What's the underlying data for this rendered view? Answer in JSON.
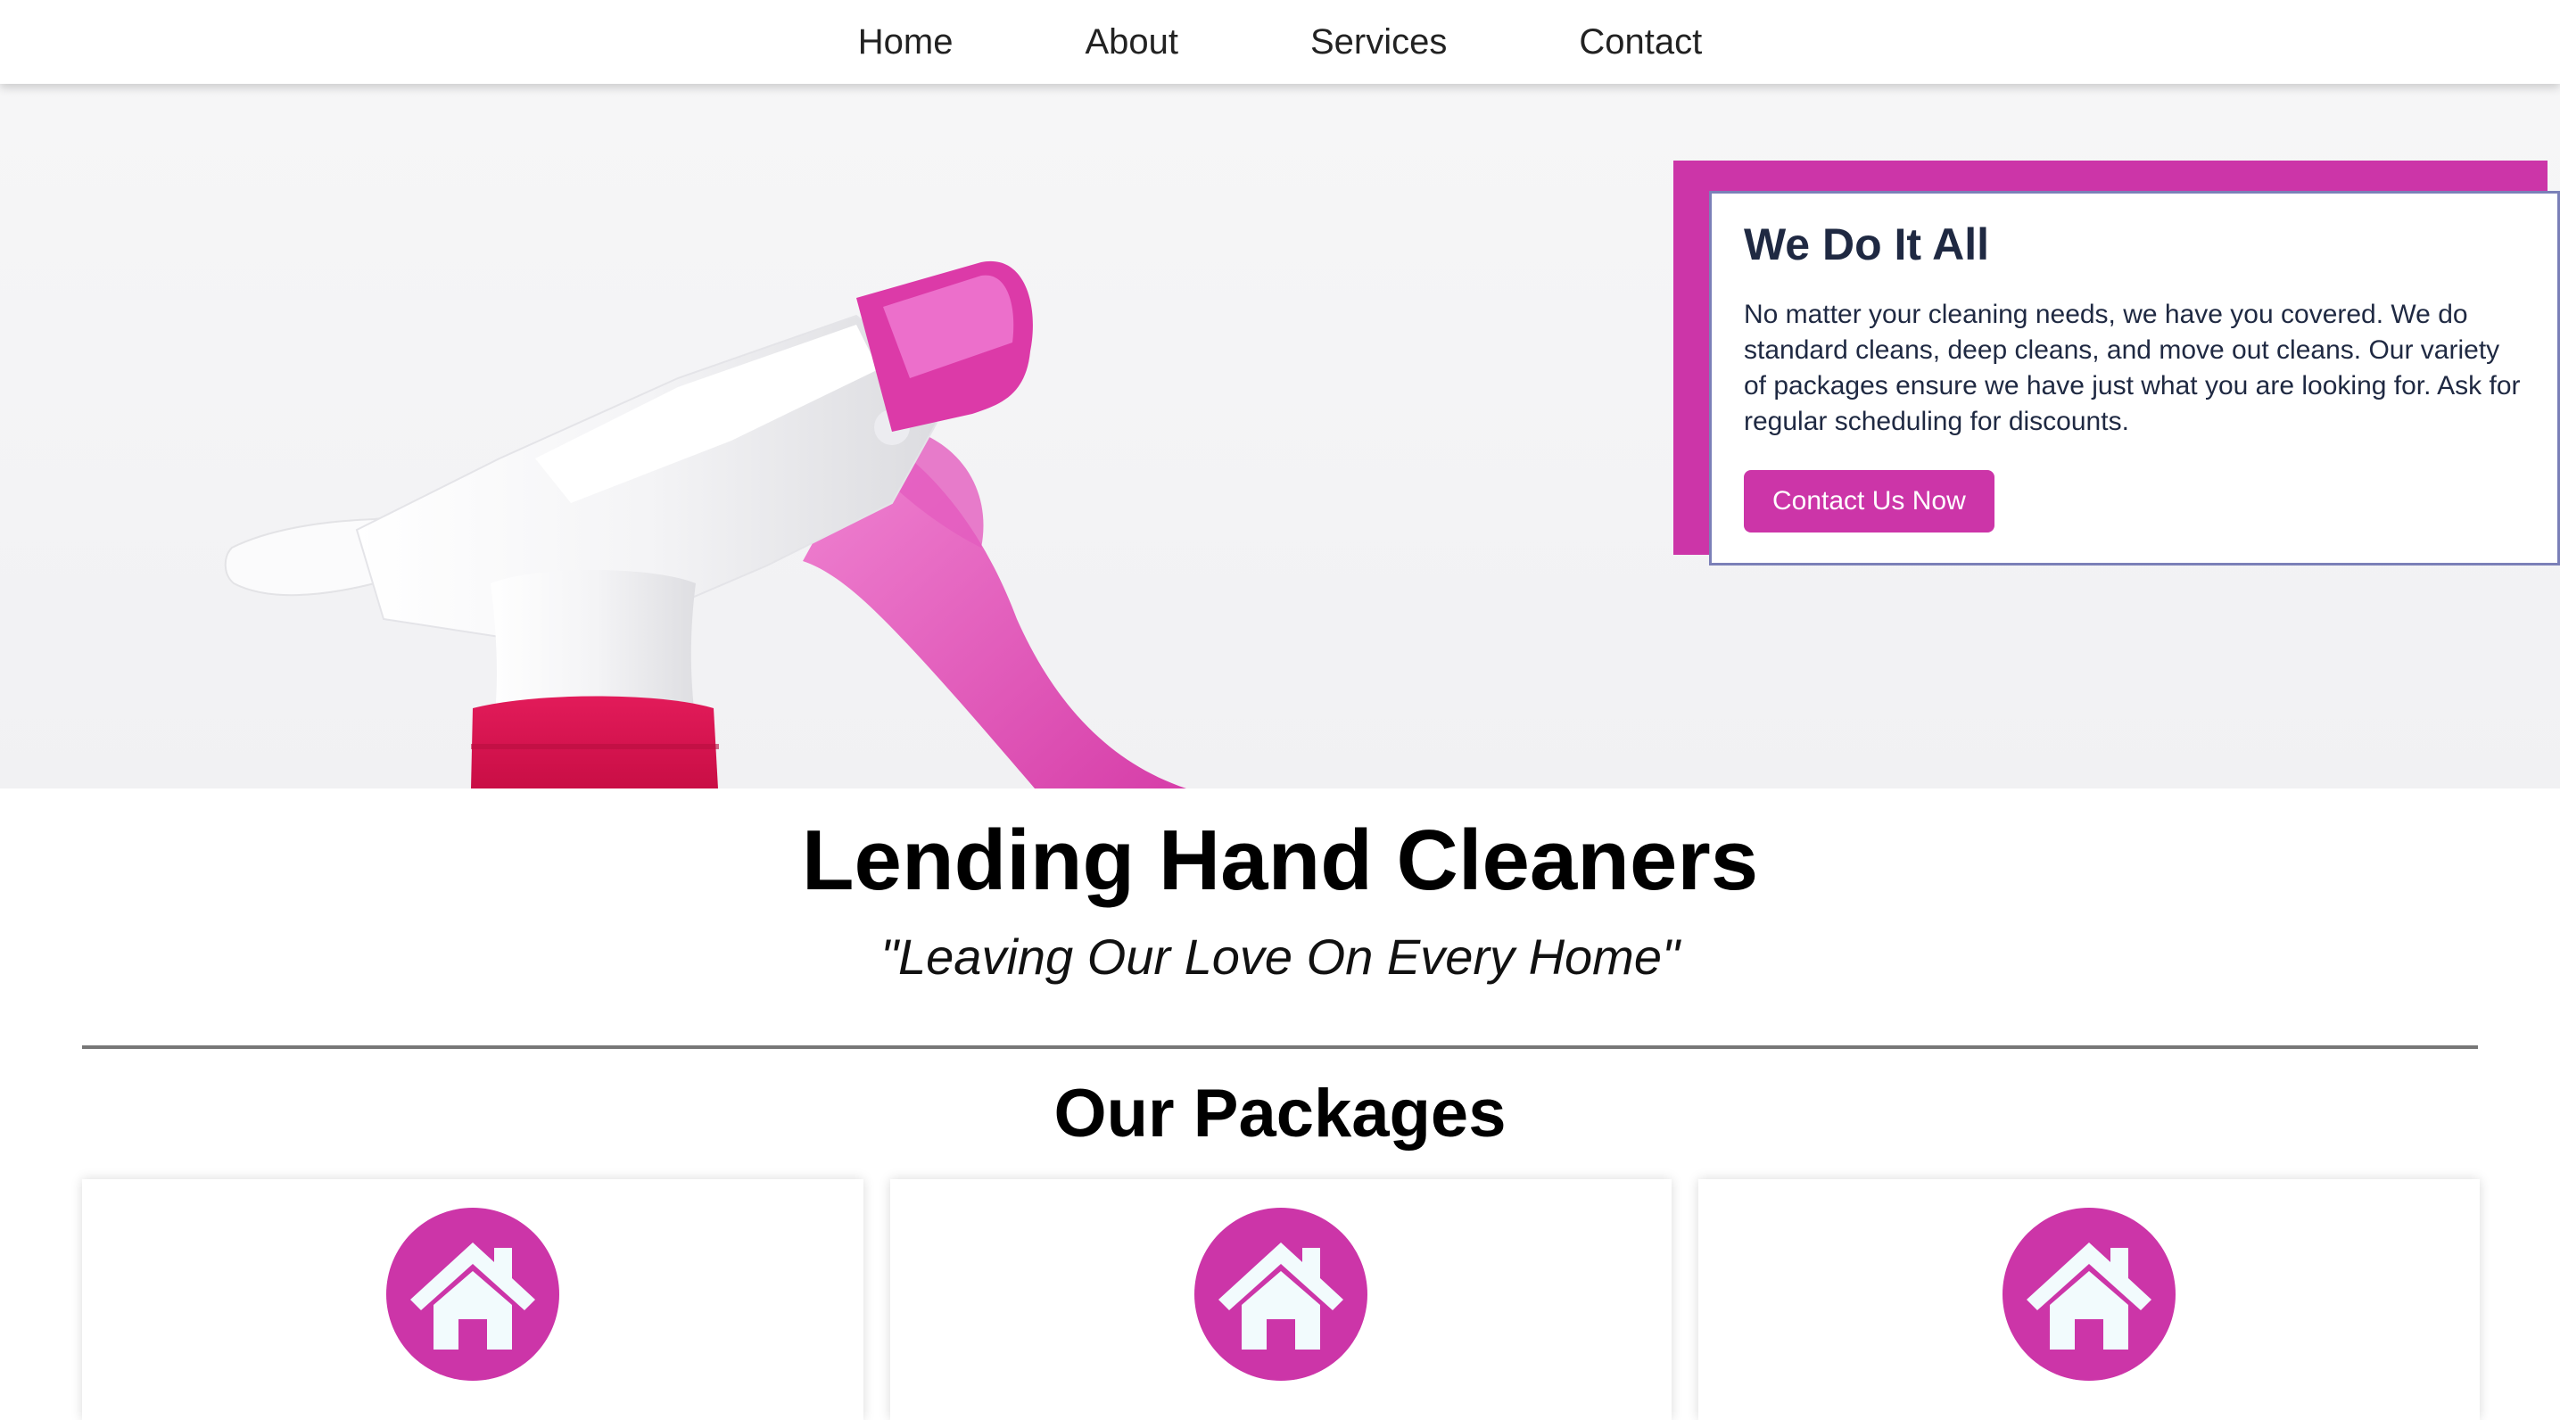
{
  "nav": {
    "items": [
      {
        "label": "Home"
      },
      {
        "label": "About"
      },
      {
        "label": "Services"
      },
      {
        "label": "Contact"
      }
    ]
  },
  "hero": {
    "image_icon": "spray-bottle-image",
    "card": {
      "title": "We Do It All",
      "text": "No matter your cleaning needs, we have you covered. We do standard cleans, deep cleans, and move out cleans. Our variety of packages ensure we have just what you are looking for. Ask for regular scheduling for discounts.",
      "button_label": "Contact Us Now"
    }
  },
  "brand": {
    "name": "Lending Hand Cleaners",
    "tagline": "\"Leaving Our Love On Every Home\""
  },
  "packages": {
    "title": "Our Packages",
    "cards": [
      {
        "icon": "house-icon"
      },
      {
        "icon": "house-icon"
      },
      {
        "icon": "house-icon"
      }
    ]
  },
  "colors": {
    "accent": "#cc35a8",
    "dark_text": "#1f2942",
    "card_border": "#7b80b8",
    "icon_fill": "#f2fbfd"
  }
}
